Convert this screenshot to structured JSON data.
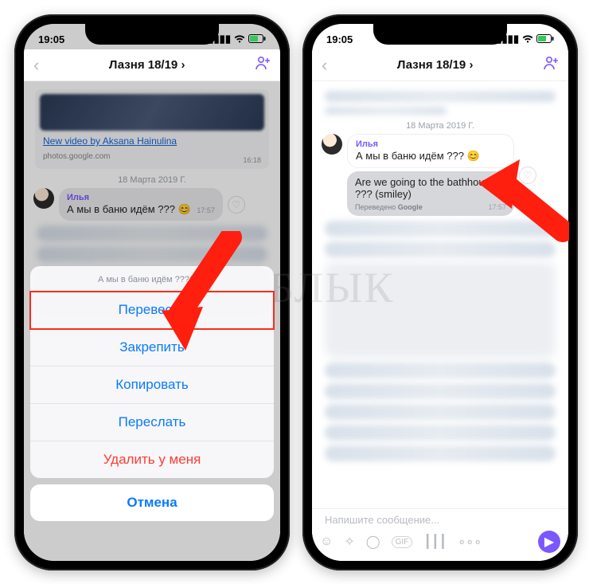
{
  "status": {
    "time": "19:05"
  },
  "header": {
    "title": "Лазня 18/19 ›"
  },
  "linkcard": {
    "title": "New video by Aksana Hainulina",
    "source": "photos.google.com",
    "time": "16:18"
  },
  "date_separator": "18 Марта 2019 Г.",
  "message": {
    "author": "Илья",
    "text": "А мы в баню идём ???",
    "emoji": "😊",
    "time": "17:57"
  },
  "translation": {
    "text": "Are we going to the bathhouse ??? (smiley)",
    "credit_prefix": "Переведено ",
    "credit_brand": "Google"
  },
  "sheet": {
    "context": "А мы в баню идём ???(😊)",
    "translate": "Перевести",
    "pin": "Закрепить",
    "copy": "Копировать",
    "forward": "Переслать",
    "delete": "Удалить у меня",
    "cancel": "Отмена"
  },
  "composer": {
    "placeholder": "Напишите сообщение..."
  },
  "watermark": "ЯБЛЫК"
}
